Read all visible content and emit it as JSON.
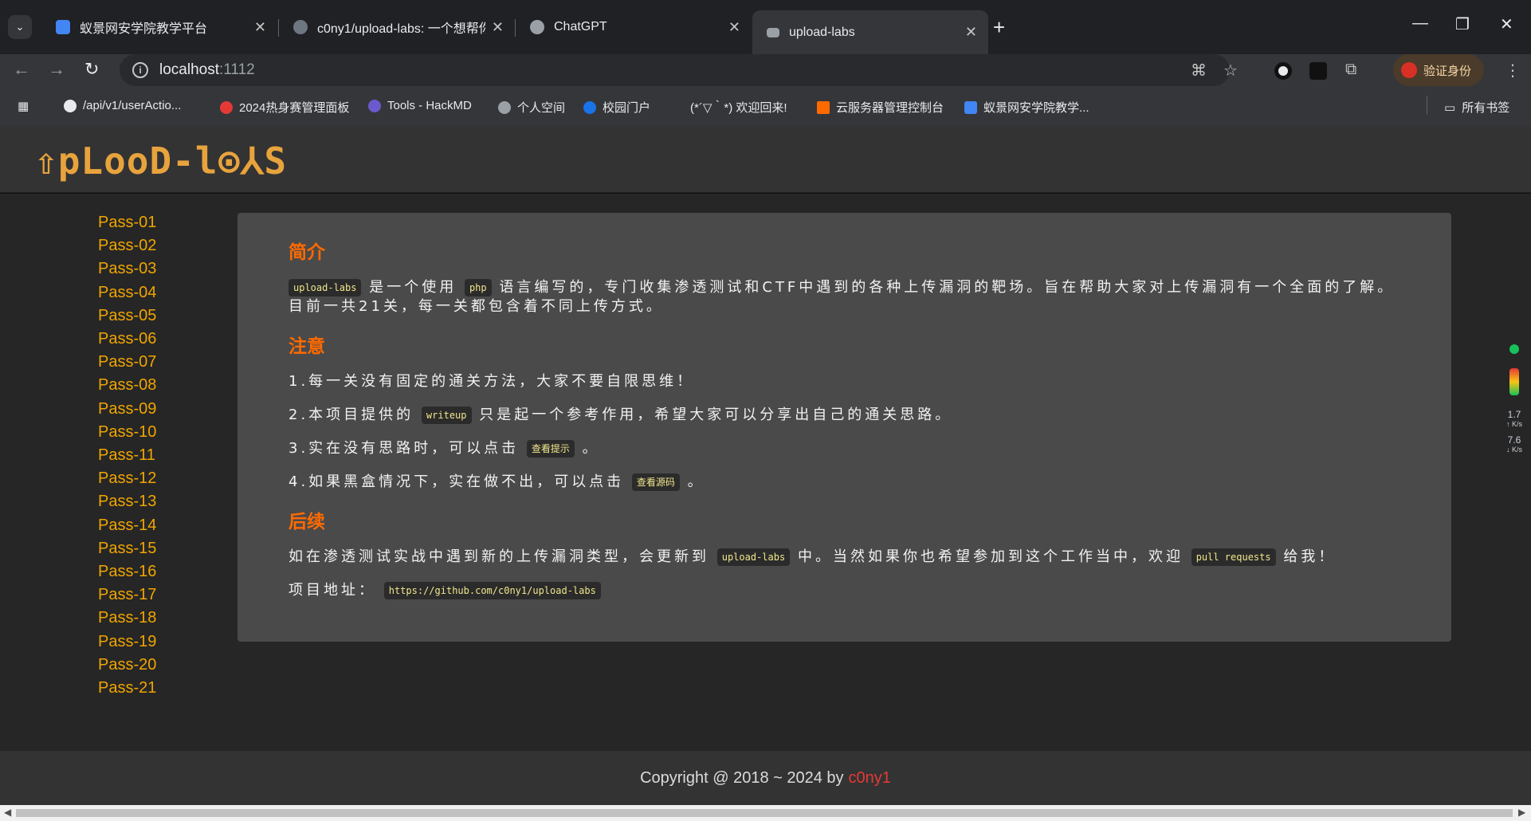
{
  "browser": {
    "tabs": [
      {
        "title": "蚁景网安学院教学平台",
        "color": "#4285f4"
      },
      {
        "title": "c0ny1/upload-labs: 一个想帮你",
        "color": "#9aa0a6"
      },
      {
        "title": "ChatGPT",
        "color": "#9aa0a6"
      },
      {
        "title": "upload-labs",
        "color": "#9aa0a6"
      }
    ],
    "url_host": "localhost",
    "url_port": ":1112",
    "profile_label": "验证身份",
    "bookmarks": [
      {
        "label": "/api/v1/userActio...",
        "color": "#e8eaed"
      },
      {
        "label": "2024热身赛管理面板",
        "color": "#e53935"
      },
      {
        "label": "Tools - HackMD",
        "color": "#6a5acd"
      },
      {
        "label": "个人空间",
        "color": "#9aa0a6"
      },
      {
        "label": "校园门户",
        "color": "#1a73e8"
      },
      {
        "label": "(*´▽｀*) 欢迎回来!",
        "color": "#35363a"
      },
      {
        "label": "云服务器管理控制台",
        "color": "#ff6a00"
      },
      {
        "label": "蚁景网安学院教学...",
        "color": "#4285f4"
      }
    ],
    "all_bookmarks": "所有书签"
  },
  "site": {
    "logo": "⇧pLooD-l⊙⅄S",
    "passes": [
      "Pass-01",
      "Pass-02",
      "Pass-03",
      "Pass-04",
      "Pass-05",
      "Pass-06",
      "Pass-07",
      "Pass-08",
      "Pass-09",
      "Pass-10",
      "Pass-11",
      "Pass-12",
      "Pass-13",
      "Pass-14",
      "Pass-15",
      "Pass-16",
      "Pass-17",
      "Pass-18",
      "Pass-19",
      "Pass-20",
      "Pass-21"
    ],
    "intro": {
      "title": "简介",
      "code1": "upload-labs",
      "text1": "是一个使用",
      "code2": "php",
      "text2": "语言编写的，专门收集渗透测试和CTF中遇到的各种上传漏洞的靶场。旨在帮助大家对上传漏洞有一个全面的了解。目前一共21关，每一关都包含着不同上传方式。"
    },
    "notice": {
      "title": "注意",
      "item1": "1.每一关没有固定的通关方法，大家不要自限思维！",
      "item2_pre": "2.本项目提供的",
      "item2_code": "writeup",
      "item2_post": "只是起一个参考作用，希望大家可以分享出自己的通关思路。",
      "item3_pre": "3.实在没有思路时，可以点击",
      "item3_code": "查看提示",
      "item3_post": "。",
      "item4_pre": "4.如果黑盒情况下，实在做不出，可以点击",
      "item4_code": "查看源码",
      "item4_post": "。"
    },
    "followup": {
      "title": "后续",
      "text_pre": "如在渗透测试实战中遇到新的上传漏洞类型，会更新到",
      "code1": "upload-labs",
      "text_mid": "中。当然如果你也希望参加到这个工作当中，欢迎",
      "code2": "pull requests",
      "text_post": "给我！",
      "addr_label": "项目地址：",
      "addr_url": "https://github.com/c0ny1/upload-labs"
    },
    "footer_text": "Copyright @ 2018 ~ 2024 by",
    "footer_author": "c0ny1"
  },
  "widget": {
    "up_speed": "1.7",
    "up_unit": "↑ K/s",
    "down_speed": "7.6",
    "down_unit": "↓ K/s"
  }
}
